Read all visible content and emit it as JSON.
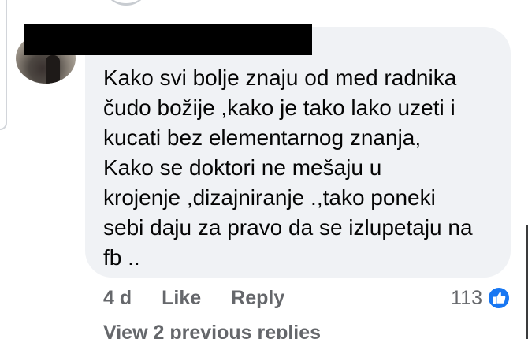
{
  "comment": {
    "author_name": "",
    "text": "Kako svi bolje znaju od med radnika\nčudo božije ,kako je tako lako uzeti i\nkucati bez elementarnog znanja,\nKako se doktori ne mešaju u\nkrojenje ,dizajniranje .,tako poneki\nsebi daju za pravo da se izlupetaju na\nfb ..",
    "time": "4 d",
    "like_label": "Like",
    "reply_label": "Reply",
    "reaction_count": "113",
    "reaction_icon": "like-icon",
    "reaction_color": "#1877f2"
  },
  "replies": {
    "view_previous_label": "View 2 previous replies"
  },
  "colors": {
    "bubble": "#f0f2f5",
    "text": "#050505",
    "secondary": "#65676b"
  }
}
